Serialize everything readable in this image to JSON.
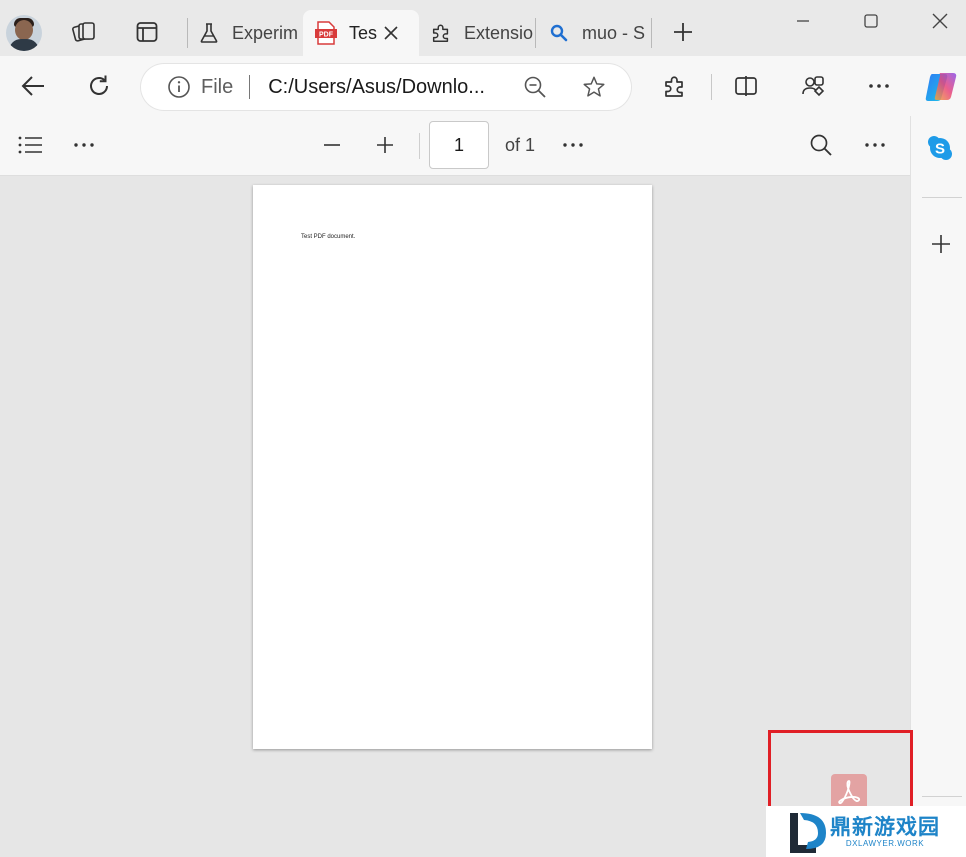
{
  "tabstrip": {
    "tabs": [
      {
        "label": "Experim",
        "icon": "flask-icon"
      },
      {
        "label": "Tes",
        "icon": "pdf-icon",
        "active": true
      },
      {
        "label": "Extensio",
        "icon": "puzzle-icon"
      },
      {
        "label": "muo - S",
        "icon": "search-icon"
      }
    ],
    "pdf_badge": "PDF"
  },
  "address_bar": {
    "protocol": "File",
    "url": "C:/Users/Asus/Downlo..."
  },
  "pdf_toolbar": {
    "current_page": "1",
    "of_label": "of 1"
  },
  "document": {
    "text": "Test PDF document."
  },
  "watermark": {
    "title": "鼎新游戏园",
    "subtitle": "DXLAWYER.WORK"
  },
  "colors": {
    "highlight": "#e01f26",
    "pdf_icon_red": "#d83b3b",
    "skype_blue": "#1e9be8",
    "acrobat_bg": "#e3a3a3"
  }
}
